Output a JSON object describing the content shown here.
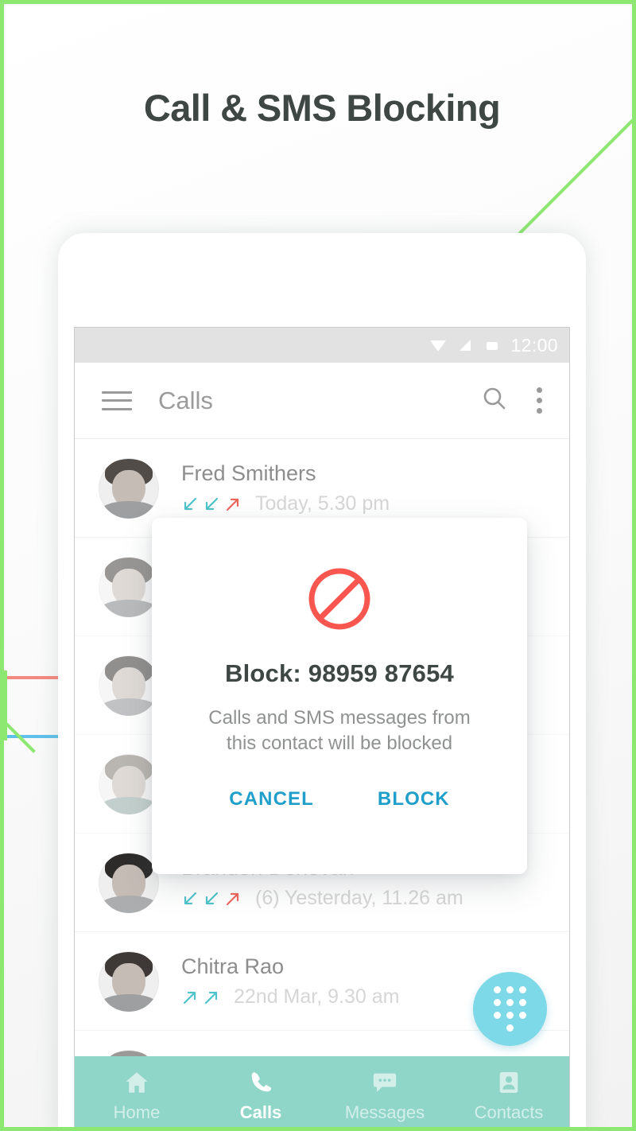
{
  "headline": "Call & SMS Blocking",
  "colors": {
    "page_border_green": "#8CE870",
    "accent_teal": "#1F9FC9",
    "nav_bar": "#8FD5C8",
    "fab": "#7DD8E8",
    "block_red": "#F8564F",
    "incoming_arrow": "#4EC3C9",
    "outgoing_arrow": "#F0675E"
  },
  "statusbar": {
    "time": "12:00",
    "icons": [
      "wifi-icon",
      "signal-icon",
      "battery-icon"
    ]
  },
  "appbar": {
    "menu_icon": "hamburger-icon",
    "title": "Calls",
    "search_icon": "search-icon",
    "overflow_icon": "overflow-menu-icon"
  },
  "calls": [
    {
      "name": "Fred Smithers",
      "time": "Today, 5.30 pm",
      "arrows": [
        "incoming",
        "incoming",
        "outgoing"
      ],
      "avatar": "man-short-beard"
    },
    {
      "name": "",
      "time": "",
      "arrows": [],
      "avatar": "man-glasses-beard"
    },
    {
      "name": "",
      "time": "",
      "arrows": [],
      "avatar": "woman-dark-hair"
    },
    {
      "name": "",
      "time": "",
      "arrows": [],
      "avatar": "woman-glasses-blonde"
    },
    {
      "name": "Brandon Donovan",
      "time": "(6) Yesterday, 11.26 am",
      "arrows": [
        "incoming",
        "incoming",
        "outgoing"
      ],
      "avatar": "man-smiling"
    },
    {
      "name": "Chitra Rao",
      "time": "22nd Mar, 9.30 am",
      "arrows": [
        "outgoing-teal",
        "outgoing-teal"
      ],
      "avatar": "woman-curly-hair"
    }
  ],
  "fab": {
    "icon": "dialpad-icon"
  },
  "bottom_nav": {
    "items": [
      {
        "label": "Home",
        "icon": "home-icon",
        "active": false
      },
      {
        "label": "Calls",
        "icon": "phone-icon",
        "active": true
      },
      {
        "label": "Messages",
        "icon": "message-bubble-icon",
        "active": false
      },
      {
        "label": "Contacts",
        "icon": "contact-card-icon",
        "active": false
      }
    ]
  },
  "dialog": {
    "icon": "block-prohibition-icon",
    "title": "Block: 98959 87654",
    "message": "Calls and SMS messages from this contact will be blocked",
    "cancel_label": "CANCEL",
    "block_label": "BLOCK"
  }
}
